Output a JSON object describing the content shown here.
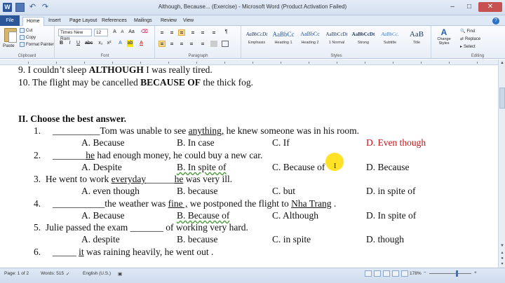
{
  "titlebar": {
    "title": "Although, Because... (Exercise) - Microsoft Word (Product Activation Failed)",
    "logo_letter": "W",
    "minimize": "–",
    "maximize": "□",
    "close": "✕"
  },
  "tabs": [
    "File",
    "Home",
    "Insert",
    "Page Layout",
    "References",
    "Mailings",
    "Review",
    "View"
  ],
  "ribbon": {
    "clipboard": {
      "paste": "Paste",
      "cut": "Cut",
      "copy": "Copy",
      "format_painter": "Format Painter",
      "label": "Clipboard"
    },
    "font": {
      "name": "Times New Rom",
      "size": "12",
      "label": "Font",
      "bold": "B",
      "italic": "I",
      "underline": "U"
    },
    "paragraph": {
      "label": "Paragraph",
      "show_marks": "¶"
    },
    "styles": {
      "label": "Styles",
      "items": [
        {
          "sample": "AaBbCcDt",
          "name": "Emphasis"
        },
        {
          "sample": "AaBbCc",
          "name": "Heading 1"
        },
        {
          "sample": "AaBbCc",
          "name": "Heading 2"
        },
        {
          "sample": "AaBbCcDt",
          "name": "1 Normal"
        },
        {
          "sample": "AaBbCcDt",
          "name": "Strong"
        },
        {
          "sample": "AaBbCc.",
          "name": "Subtitle"
        },
        {
          "sample": "AaB",
          "name": "Title"
        }
      ],
      "change_styles": "Change Styles"
    },
    "editing": {
      "find": "Find",
      "replace": "Replace",
      "select": "Select",
      "label": "Editing"
    }
  },
  "document": {
    "line9": {
      "pre": "9. I couldn’t sleep ",
      "kw": "ALTHOUGH",
      "post": " I was really tired."
    },
    "line10": {
      "pre": "10. The flight may be cancelled ",
      "kw": "BECAUSE OF",
      "post": " the  thick fog."
    },
    "heading": "II.  Choose the best answer.",
    "questions": [
      {
        "num": "1.",
        "blank": "__________",
        "parts": [
          "Tom was unable to see ",
          "anything,",
          " he knew someone was in his room."
        ]
      },
      {
        "num": "2.",
        "blank": "_______",
        "parts": [
          "he",
          " had enough money, he could buy a new car."
        ]
      },
      {
        "num": "3.",
        "text_a": "He went to work ",
        "wavy": "everyday",
        "blank": "______",
        "text_b": "he",
        " text_c": "",
        "post": " was very ill."
      },
      {
        "num": "4.",
        "blank": "___________",
        "parts": [
          "the weather was ",
          "fine ,",
          " we postponed the flight to ",
          "Nha Trang",
          " ."
        ]
      },
      {
        "num": "5.",
        "text": "Julie passed the exam ",
        "blank": "_______",
        "post": " of working very hard."
      },
      {
        "num": "6.",
        "blank": "_____",
        "parts": [
          "it",
          " was raining heavily, he went out ."
        ]
      }
    ],
    "answers": [
      [
        "A. Because",
        "B. In case",
        "C. If",
        "D. Even though"
      ],
      [
        "A. Despite",
        "B. In spite of",
        "C. Because of",
        "D. Because"
      ],
      [
        "A. even though",
        "B. because",
        "C. but",
        "D. in spite of"
      ],
      [
        "A. Because",
        "B. Because of",
        "C. Although",
        "D. In spite of"
      ],
      [
        "A. despite",
        "B. because",
        "C. in spite",
        "D. though"
      ]
    ]
  },
  "statusbar": {
    "page": "Page: 1 of 2",
    "words": "Words: 515",
    "language": "English (U.S.)",
    "zoom": "178%"
  }
}
